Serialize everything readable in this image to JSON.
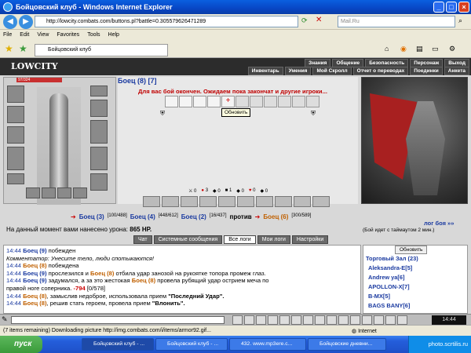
{
  "window": {
    "title": "Бойцовский клуб - Windows Internet Explorer"
  },
  "address": {
    "url": "http://lowcity.combats.com/buttons.pl?battle=0.305579626471289",
    "search_placeholder": "Mail.Ru"
  },
  "menu": {
    "items": [
      "File",
      "Edit",
      "View",
      "Favorites",
      "Tools",
      "Help"
    ]
  },
  "tab": {
    "label": "Бойцовский клуб"
  },
  "game": {
    "logo": "LOWCITY",
    "nav_top": [
      "Знания",
      "Общение",
      "Безопасность",
      "Персонаж",
      "Выход"
    ],
    "nav_bottom": [
      "Инвентарь",
      "Умения",
      "Мой Скролл",
      "Отчет о переводах",
      "Поединки",
      "Анкета"
    ],
    "hp": "97/324",
    "opponent": "Боец (8) [7]",
    "wait_message": "Для вас бой окончен. Ожидаем пока закончат и другие игроки...",
    "tooltip": "Обновить",
    "stats": [
      "0",
      "3",
      "0",
      "1",
      "0",
      "0",
      "0"
    ],
    "teams": [
      {
        "name": "Боец (3)",
        "hp": "[100/488]"
      },
      {
        "name": "Боец (4)",
        "hp": "[448/612]"
      },
      {
        "name": "Боец (2)",
        "hp": "[16/437]"
      },
      {
        "vs": "против"
      },
      {
        "name": "Боец (6)",
        "hp": "[300/589]"
      }
    ],
    "damage_label": "На данный момент вами нанесено урона:",
    "damage_value": "865 HP.",
    "log_link": "лог боя »»",
    "timer": "(Бой идет с таймаутом 2 мин.)",
    "chat_tabs": [
      "Чат",
      "Системные сообщения",
      "Все логи",
      "Мои логи",
      "Настройки"
    ],
    "log_lines": [
      {
        "time": "14:44",
        "p1": "Боец (9)",
        "text": " побежден"
      },
      {
        "comment": "Комментатор: Унесите тело, люди спотыкаются!"
      },
      {
        "time": "14:44",
        "p1": "Боец (8)",
        "text": " побеждена"
      },
      {
        "time": "14:44",
        "p1": "Боец (9)",
        "text": " прослезился и ",
        "p2": "Боец (8)",
        "text2": " отбила удар занозой на рукоятке топора промеж глаз."
      },
      {
        "time": "14:44",
        "p1": "Боец (9)",
        "text": " задумался, а за это жестокая ",
        "p2": "Боец (8)",
        "text2": " провела рубящий удар острием меча по"
      },
      {
        "cont": "правой ноге соперника.",
        "dmg": "-794",
        "tail": "[0/578]"
      },
      {
        "time": "14:44",
        "p1": "Боец (8)",
        "text": ", замыслив недоброе, использовала прием ",
        "quote": "\"Последний Удар\"."
      },
      {
        "time": "14:44",
        "p1": "Боец (8)",
        "text": ", решив стать героем, провела прием ",
        "quote": "\"Влонить\"."
      }
    ],
    "market": {
      "refresh": "Обновить",
      "title": "Торговый Зал (23)",
      "users": [
        "Aleksandra-E[5]",
        "Andrew ya[6]",
        "APOLLON-X[7]",
        "B-MX[5]",
        "BAGS BANY[6]"
      ]
    },
    "clock": "14:44"
  },
  "status": {
    "text": "(7 items remaining) Downloading picture http://img.combats.com/i/items/armor92.gif...",
    "zone": "Internet"
  },
  "taskbar": {
    "start": "пуск",
    "buttons": [
      "Бойцовский клуб - ...",
      "Бойцовский клуб - ...",
      "432. www.mp3ere.c...",
      "Бойцовские дневни..."
    ],
    "tray": "photo.scrtilis.ru"
  }
}
